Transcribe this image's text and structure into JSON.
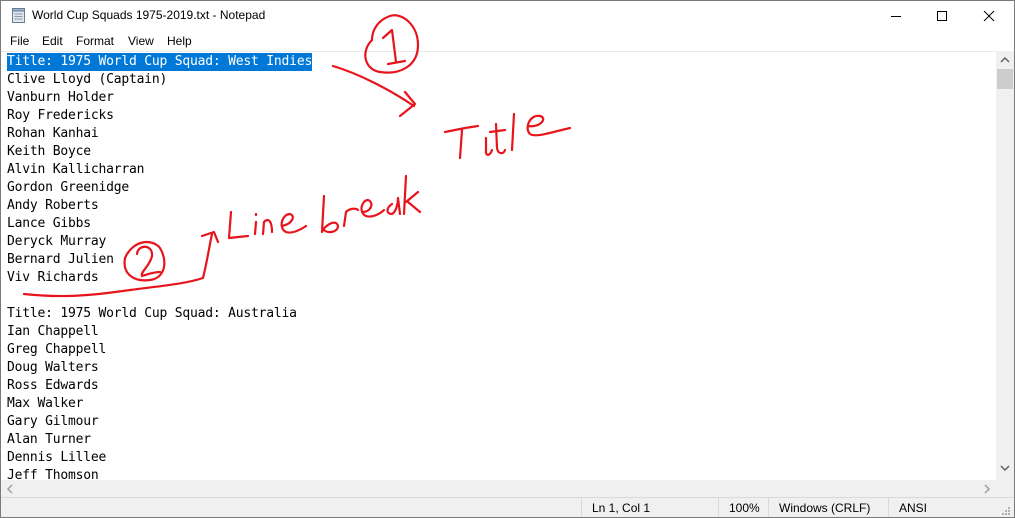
{
  "window": {
    "title": "World Cup Squads 1975-2019.txt - Notepad"
  },
  "menubar": {
    "items": [
      "File",
      "Edit",
      "Format",
      "View",
      "Help"
    ]
  },
  "editor": {
    "lines": [
      "Title: 1975 World Cup Squad: West Indies",
      "Clive Lloyd (Captain)",
      "Vanburn Holder",
      "Roy Fredericks",
      "Rohan Kanhai",
      "Keith Boyce",
      "Alvin Kallicharran",
      "Gordon Greenidge",
      "Andy Roberts",
      "Lance Gibbs",
      "Deryck Murray",
      "Bernard Julien",
      "Viv Richards",
      "",
      "Title: 1975 World Cup Squad: Australia",
      "Ian Chappell",
      "Greg Chappell",
      "Doug Walters",
      "Ross Edwards",
      "Max Walker",
      "Gary Gilmour",
      "Alan Turner",
      "Dennis Lillee",
      "Jeff Thomson"
    ],
    "selected_line_index": 0,
    "selection_color": "#0078d7"
  },
  "statusbar": {
    "position": "Ln 1, Col 1",
    "zoom": "100%",
    "line_ending": "Windows (CRLF)",
    "encoding": "ANSI"
  },
  "annotations": {
    "color": "#e8141c",
    "marker_1": "1",
    "label_1": "Title",
    "marker_2": "2",
    "label_2": "Line break"
  }
}
